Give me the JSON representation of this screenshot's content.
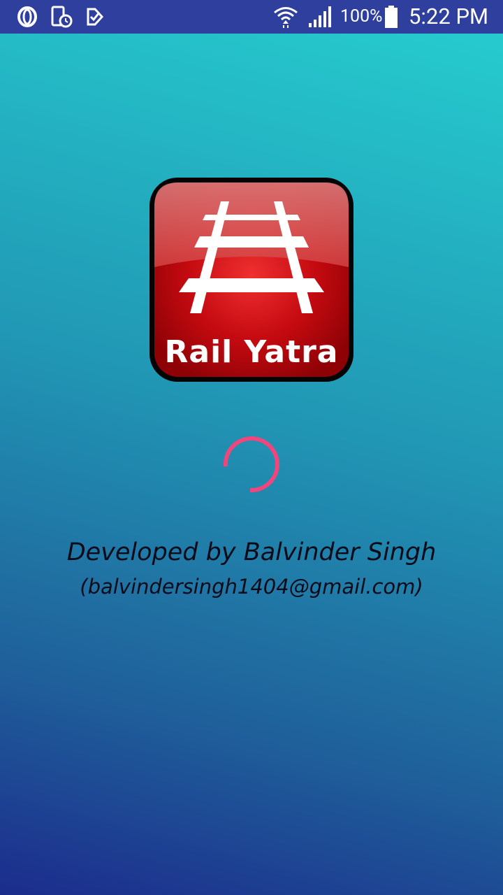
{
  "status_bar": {
    "background_color": "#2f3f9e",
    "icons": {
      "left": [
        "opera-icon",
        "screen-timer-icon",
        "delivery-check-icon"
      ],
      "right": [
        "wifi-icon",
        "cellular-signal-icon",
        "battery-icon"
      ]
    },
    "battery_percent": "100%",
    "time": "5:22 PM"
  },
  "splash": {
    "logo": {
      "text": "Rail Yatra",
      "icon": "railway-track-icon",
      "color": "#d0141a"
    },
    "spinner_color": "#f0467e",
    "developer_text": "Developed by Balvinder Singh",
    "email_text": "(balvindersingh1404@gmail.com)"
  }
}
